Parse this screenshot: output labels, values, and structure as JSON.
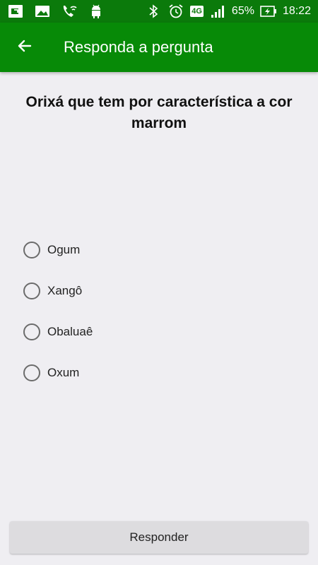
{
  "status_bar": {
    "battery_percent": "65%",
    "time": "18:22",
    "network_type": "4G",
    "left_icons": [
      "screen-mirror-icon",
      "image-icon",
      "wifi-calling-icon",
      "android-icon"
    ],
    "right_icons": [
      "bluetooth-icon",
      "alarm-icon",
      "network-4g-icon",
      "signal-icon",
      "battery-charging-icon"
    ]
  },
  "app_bar": {
    "title": "Responda a pergunta",
    "back_icon": "arrow-left-icon"
  },
  "question": {
    "text": "Orixá que tem por característica a cor marrom"
  },
  "options": [
    {
      "label": "Ogum",
      "selected": false
    },
    {
      "label": "Xangô",
      "selected": false
    },
    {
      "label": "Obaluaê",
      "selected": false
    },
    {
      "label": "Oxum",
      "selected": false
    }
  ],
  "submit": {
    "label": "Responder"
  },
  "colors": {
    "status_bar": "#0b7a0b",
    "app_bar": "#078a07",
    "background": "#efeef2",
    "button": "#dddcdf"
  }
}
